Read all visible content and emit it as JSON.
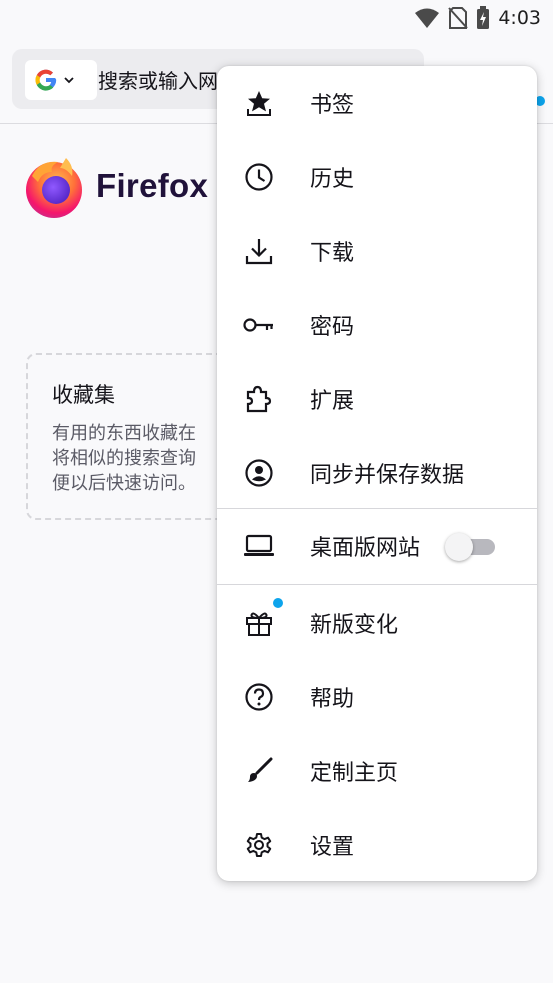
{
  "status_bar": {
    "time": "4:03",
    "icons": [
      "wifi-icon",
      "no-sim-icon",
      "battery-charging-icon"
    ]
  },
  "toolbar": {
    "search_engine": "Google",
    "placeholder": "搜索或输入网址"
  },
  "homepage": {
    "wordmark": "Firefox",
    "collections": {
      "title": "收藏集",
      "lines": [
        "有用的东西收藏在",
        "将相似的搜索查询",
        "便以后快速访问。"
      ]
    }
  },
  "menu": {
    "items": [
      {
        "label": "书签",
        "icon": "bookmark-star-icon"
      },
      {
        "label": "历史",
        "icon": "clock-icon"
      },
      {
        "label": "下载",
        "icon": "download-icon"
      },
      {
        "label": "密码",
        "icon": "key-icon"
      },
      {
        "label": "扩展",
        "icon": "puzzle-icon"
      },
      {
        "label": "同步并保存数据",
        "icon": "account-icon"
      },
      {
        "label": "桌面版网站",
        "icon": "laptop-icon",
        "toggle": false
      },
      {
        "label": "新版变化",
        "icon": "gift-icon",
        "badge": true
      },
      {
        "label": "帮助",
        "icon": "help-icon"
      },
      {
        "label": "定制主页",
        "icon": "paintbrush-icon"
      },
      {
        "label": "设置",
        "icon": "gear-icon"
      }
    ]
  },
  "colors": {
    "accent_dot": "#0da4ec",
    "background": "#f9f9fb",
    "menu_bg": "#ffffff"
  }
}
